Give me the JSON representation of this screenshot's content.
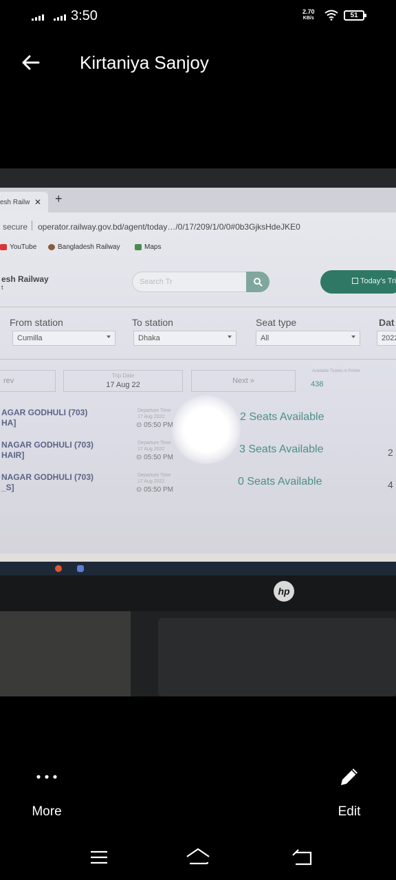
{
  "status_bar": {
    "time": "3:50",
    "net_speed_value": "2.70",
    "net_speed_unit": "KB/s",
    "battery": "51"
  },
  "app_bar": {
    "title": "Kirtaniya Sanjoy"
  },
  "photo": {
    "browser": {
      "tab_title": "esh Railw",
      "tab_close": "✕",
      "new_tab": "+",
      "secure_label": "secure",
      "url": "operator.railway.gov.bd/agent/today…/0/17/209/1/0/0#0b3GjksHdeJKE0",
      "bookmarks": [
        "YouTube",
        "Bangladesh Railway",
        "Maps"
      ]
    },
    "site": {
      "brand_line1": "esh Railway",
      "brand_line2": "t",
      "search_placeholder": "Search Tr",
      "today_button": "Today's Tri"
    },
    "filters": [
      {
        "label": "From station",
        "value": "Cumilla"
      },
      {
        "label": "To station",
        "value": "Dhaka"
      },
      {
        "label": "Seat type",
        "value": "All"
      },
      {
        "label": "Dat",
        "value": "2022"
      }
    ],
    "pager": {
      "prev": "rev",
      "trip_date_caption": "Trip Date",
      "trip_date": "17 Aug 22",
      "next": "Next »",
      "available_caption": "Available Tickets in Printer",
      "available_count": "438"
    },
    "trains": [
      {
        "name_line1": "AGAR GODHULI (703)",
        "name_line2": "HA]",
        "dep_caption_1": "Departure Time",
        "dep_caption_2": "17 Aug 2022",
        "dep_time": "05:50 PM",
        "seats": "2 Seats Available",
        "edge": ""
      },
      {
        "name_line1": "NAGAR GODHULI (703)",
        "name_line2": "HAIR]",
        "dep_caption_1": "Departure Time",
        "dep_caption_2": "17 Aug 2022",
        "dep_time": "05:50 PM",
        "seats": "3 Seats Available",
        "edge": "2"
      },
      {
        "name_line1": "NAGAR GODHULI (703)",
        "name_line2": "_S]",
        "dep_caption_1": "Departure Time",
        "dep_caption_2": "17 Aug 2022",
        "dep_time": "05:50 PM",
        "seats": "0 Seats Available",
        "edge": "4"
      }
    ],
    "hp_logo": "hp"
  },
  "actions": {
    "more_label": "More",
    "edit_label": "Edit"
  }
}
